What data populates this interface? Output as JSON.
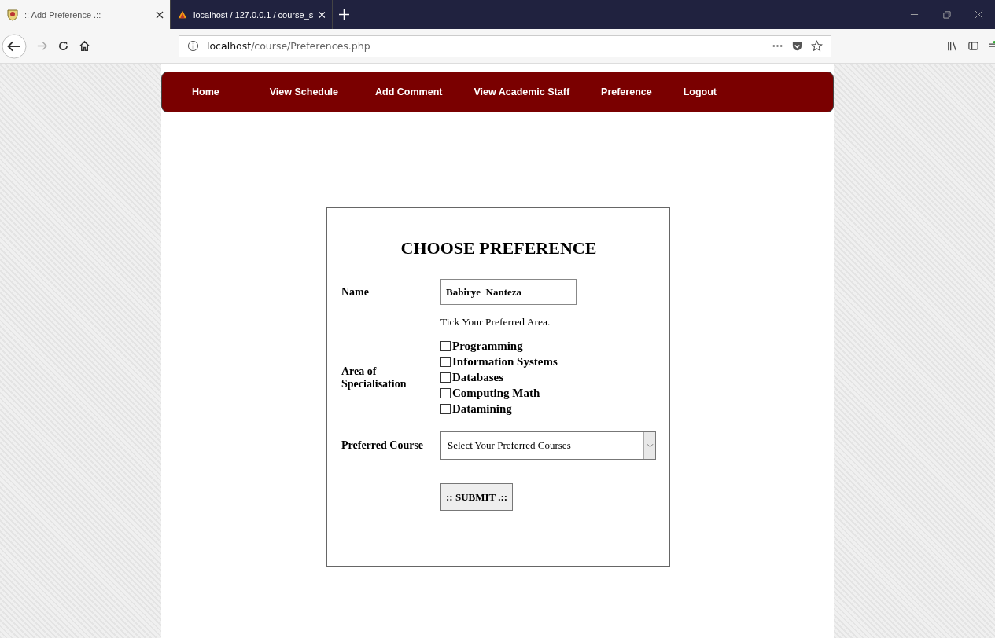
{
  "tabs": [
    {
      "label": ":: Add Preference .::",
      "selected": true
    },
    {
      "label": "localhost / 127.0.0.1 / course_s",
      "selected": false
    }
  ],
  "address_bar": {
    "host": "localhost",
    "path": "/course/Preferences.php"
  },
  "nav": [
    "Home",
    "View Schedule",
    "Add Comment",
    "View Academic Staff",
    "Preference",
    "Logout"
  ],
  "form": {
    "title": "CHOOSE PREFERENCE",
    "name_label": "Name",
    "name_value": "Babirye  Nanteza",
    "hint": "Tick Your Preferred Area.",
    "area_label": "Area of Specialisation",
    "areas": [
      {
        "label": "Programming",
        "checked": false
      },
      {
        "label": "Information Systems",
        "checked": false
      },
      {
        "label": "Databases",
        "checked": false
      },
      {
        "label": "Computing Math",
        "checked": false
      },
      {
        "label": "Datamining",
        "checked": false
      }
    ],
    "course_label": "Preferred Course",
    "course_value": "Select Your Preferred Courses",
    "submit": ":: SUBMIT .::"
  }
}
